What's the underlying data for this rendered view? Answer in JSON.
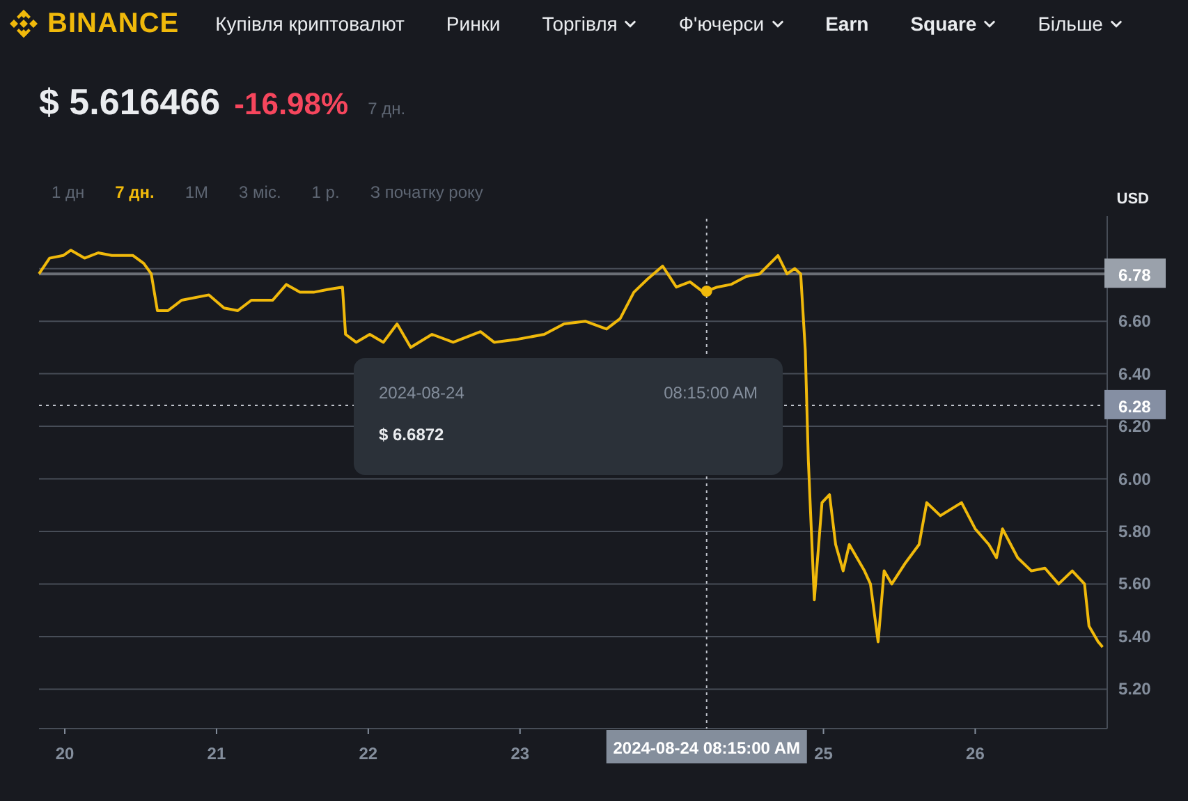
{
  "nav": {
    "logo": "BINANCE",
    "items": [
      {
        "label": "Купівля криптовалют",
        "dropdown": false,
        "bold": false
      },
      {
        "label": "Ринки",
        "dropdown": false,
        "bold": false
      },
      {
        "label": "Торгівля",
        "dropdown": true,
        "bold": false
      },
      {
        "label": "Ф'ючерси",
        "dropdown": true,
        "bold": false
      },
      {
        "label": "Earn",
        "dropdown": false,
        "bold": true
      },
      {
        "label": "Square",
        "dropdown": true,
        "bold": true
      },
      {
        "label": "Більше",
        "dropdown": true,
        "bold": false
      }
    ]
  },
  "price": {
    "value": "$ 5.616466",
    "change": "-16.98%",
    "period": "7 дн."
  },
  "ranges": [
    {
      "label": "1 дн",
      "selected": false
    },
    {
      "label": "7 дн.",
      "selected": true
    },
    {
      "label": "1M",
      "selected": false
    },
    {
      "label": "3 міс.",
      "selected": false
    },
    {
      "label": "1 р.",
      "selected": false
    },
    {
      "label": "З початку року",
      "selected": false
    }
  ],
  "chart": {
    "tooltip": {
      "date": "2024-08-24",
      "time": "08:15:00 AM",
      "price": "$ 6.6872"
    },
    "chart_data": {
      "type": "line",
      "grid": true,
      "xlim": [
        19.83,
        26.87
      ],
      "ylim": [
        5.05,
        6.99
      ],
      "xticks": [
        20,
        21,
        22,
        23,
        25,
        26
      ],
      "yticks": [
        {
          "value": 5.2,
          "label": "5.20"
        },
        {
          "value": 5.4,
          "label": "5.40"
        },
        {
          "value": 5.6,
          "label": "5.60"
        },
        {
          "value": 5.8,
          "label": "5.80"
        },
        {
          "value": 6.0,
          "label": "6.00"
        },
        {
          "value": 6.2,
          "label": "6.20"
        },
        {
          "value": 6.4,
          "label": "6.40"
        },
        {
          "value": 6.6,
          "label": "6.60"
        }
      ],
      "x": [
        19.83,
        19.9,
        19.99,
        20.04,
        20.13,
        20.22,
        20.31,
        20.45,
        20.52,
        20.57,
        20.61,
        20.68,
        20.77,
        20.95,
        21.05,
        21.14,
        21.23,
        21.37,
        21.46,
        21.55,
        21.64,
        21.73,
        21.83,
        21.85,
        21.92,
        22.01,
        22.1,
        22.19,
        22.28,
        22.42,
        22.56,
        22.74,
        22.83,
        22.97,
        23.16,
        23.29,
        23.43,
        23.57,
        23.66,
        23.75,
        23.84,
        23.94,
        24.03,
        24.12,
        24.21,
        24.3,
        24.39,
        24.49,
        24.58,
        24.7,
        24.76,
        24.81,
        24.85,
        24.88,
        24.9,
        24.94,
        24.99,
        25.04,
        25.08,
        25.13,
        25.17,
        25.27,
        25.31,
        25.36,
        25.4,
        25.45,
        25.54,
        25.63,
        25.68,
        25.77,
        25.91,
        26.0,
        26.09,
        26.14,
        26.18,
        26.28,
        26.37,
        26.46,
        26.55,
        26.64,
        26.72,
        26.75,
        26.81,
        26.84
      ],
      "series": [
        {
          "name": "USD",
          "color": "#f0b90b",
          "values": [
            6.78,
            6.84,
            6.85,
            6.87,
            6.84,
            6.86,
            6.85,
            6.85,
            6.82,
            6.78,
            6.64,
            6.64,
            6.68,
            6.7,
            6.65,
            6.64,
            6.68,
            6.68,
            6.74,
            6.71,
            6.71,
            6.72,
            6.73,
            6.55,
            6.52,
            6.55,
            6.52,
            6.59,
            6.5,
            6.55,
            6.52,
            6.56,
            6.52,
            6.53,
            6.55,
            6.59,
            6.6,
            6.57,
            6.61,
            6.71,
            6.76,
            6.81,
            6.73,
            6.75,
            6.71,
            6.73,
            6.74,
            6.77,
            6.78,
            6.85,
            6.78,
            6.8,
            6.78,
            6.49,
            6.07,
            5.54,
            5.91,
            5.94,
            5.75,
            5.65,
            5.75,
            5.65,
            5.6,
            5.38,
            5.65,
            5.6,
            5.68,
            5.75,
            5.91,
            5.86,
            5.91,
            5.81,
            5.75,
            5.7,
            5.81,
            5.7,
            5.65,
            5.66,
            5.6,
            5.65,
            5.6,
            5.44,
            5.38,
            5.36
          ]
        }
      ],
      "ref_lines": [
        {
          "axis": "y",
          "value": 6.78,
          "label": "6.78"
        },
        {
          "axis": "y",
          "value": 6.28,
          "label": "6.28"
        }
      ],
      "annotations": [
        {
          "x": 24.23,
          "text": "2024-08-24 08:15:00 AM"
        }
      ]
    }
  }
}
